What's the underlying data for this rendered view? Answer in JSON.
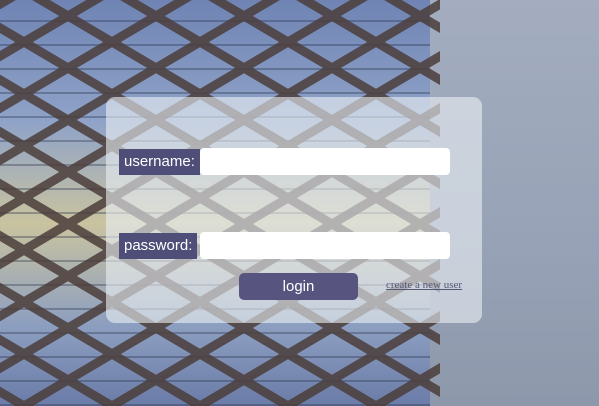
{
  "login": {
    "username_label": "username:",
    "username_value": "",
    "password_label": "password:",
    "password_value": "",
    "login_button": "login",
    "create_user_link": "create a new user"
  },
  "colors": {
    "label_bg": "#4f4e78",
    "button_bg": "#57557f",
    "panel_bg": "rgba(232,238,242,0.62)",
    "link": "#55577a"
  }
}
